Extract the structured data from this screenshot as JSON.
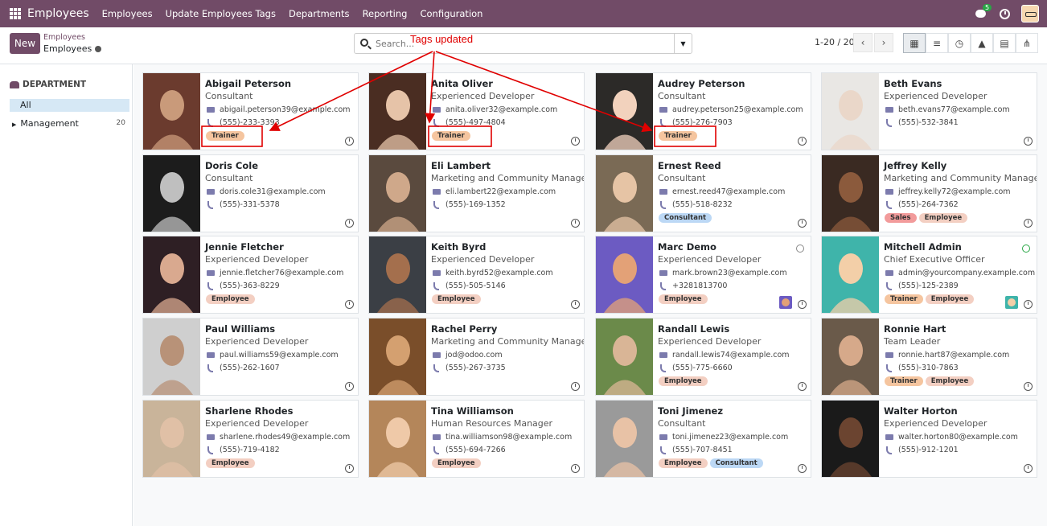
{
  "navbar": {
    "app_name": "Employees",
    "menu": [
      "Employees",
      "Update Employees Tags",
      "Departments",
      "Reporting",
      "Configuration"
    ],
    "chat_badge": "5",
    "accent_color": "#714B67"
  },
  "control_panel": {
    "new_label": "New",
    "breadcrumb_parent": "Employees",
    "breadcrumb_current": "Employees",
    "search_placeholder": "Search...",
    "pager": "1-20 / 20",
    "views": [
      "kanban-icon",
      "list-icon",
      "activity-icon",
      "graph-icon",
      "pivot-icon",
      "hierarchy-icon"
    ],
    "active_view": "kanban"
  },
  "sidebar": {
    "heading": "DEPARTMENT",
    "items": [
      {
        "label": "All",
        "selected": true
      },
      {
        "label": "Management",
        "count": "20"
      }
    ]
  },
  "annotation": {
    "text": "Tags updated",
    "color": "#e00000"
  },
  "employees": [
    {
      "name": "Abigail Peterson",
      "job": "Consultant",
      "email": "abigail.peterson39@example.com",
      "phone": "(555)-233-3393",
      "tags": [
        "Trainer"
      ],
      "status": "",
      "highlight": true
    },
    {
      "name": "Anita Oliver",
      "job": "Experienced Developer",
      "email": "anita.oliver32@example.com",
      "phone": "(555)-497-4804",
      "tags": [
        "Trainer"
      ],
      "status": "",
      "highlight": true
    },
    {
      "name": "Audrey Peterson",
      "job": "Consultant",
      "email": "audrey.peterson25@example.com",
      "phone": "(555)-276-7903",
      "tags": [
        "Trainer"
      ],
      "status": "",
      "highlight": true
    },
    {
      "name": "Beth Evans",
      "job": "Experienced Developer",
      "email": "beth.evans77@example.com",
      "phone": "(555)-532-3841",
      "tags": [],
      "status": ""
    },
    {
      "name": "Doris Cole",
      "job": "Consultant",
      "email": "doris.cole31@example.com",
      "phone": "(555)-331-5378",
      "tags": [],
      "status": ""
    },
    {
      "name": "Eli Lambert",
      "job": "Marketing and Community Manager",
      "email": "eli.lambert22@example.com",
      "phone": "(555)-169-1352",
      "tags": [],
      "status": ""
    },
    {
      "name": "Ernest Reed",
      "job": "Consultant",
      "email": "ernest.reed47@example.com",
      "phone": "(555)-518-8232",
      "tags": [
        "Consultant"
      ],
      "status": ""
    },
    {
      "name": "Jeffrey Kelly",
      "job": "Marketing and Community Manager",
      "email": "jeffrey.kelly72@example.com",
      "phone": "(555)-264-7362",
      "tags": [
        "Sales",
        "Employee"
      ],
      "status": ""
    },
    {
      "name": "Jennie Fletcher",
      "job": "Experienced Developer",
      "email": "jennie.fletcher76@example.com",
      "phone": "(555)-363-8229",
      "tags": [
        "Employee"
      ],
      "status": ""
    },
    {
      "name": "Keith Byrd",
      "job": "Experienced Developer",
      "email": "keith.byrd52@example.com",
      "phone": "(555)-505-5146",
      "tags": [
        "Employee"
      ],
      "status": ""
    },
    {
      "name": "Marc Demo",
      "job": "Experienced Developer",
      "email": "mark.brown23@example.com",
      "phone": "+3281813700",
      "tags": [
        "Employee"
      ],
      "status": "offline",
      "manager_avatar": true
    },
    {
      "name": "Mitchell Admin",
      "job": "Chief Executive Officer",
      "email": "admin@yourcompany.example.com",
      "phone": "(555)-125-2389",
      "tags": [
        "Trainer",
        "Employee"
      ],
      "status": "online",
      "manager_avatar": true
    },
    {
      "name": "Paul Williams",
      "job": "Experienced Developer",
      "email": "paul.williams59@example.com",
      "phone": "(555)-262-1607",
      "tags": [],
      "status": ""
    },
    {
      "name": "Rachel Perry",
      "job": "Marketing and Community Manager",
      "email": "jod@odoo.com",
      "phone": "(555)-267-3735",
      "tags": [],
      "status": ""
    },
    {
      "name": "Randall Lewis",
      "job": "Experienced Developer",
      "email": "randall.lewis74@example.com",
      "phone": "(555)-775-6660",
      "tags": [
        "Employee"
      ],
      "status": ""
    },
    {
      "name": "Ronnie Hart",
      "job": "Team Leader",
      "email": "ronnie.hart87@example.com",
      "phone": "(555)-310-7863",
      "tags": [
        "Trainer",
        "Employee"
      ],
      "status": ""
    },
    {
      "name": "Sharlene Rhodes",
      "job": "Experienced Developer",
      "email": "sharlene.rhodes49@example.com",
      "phone": "(555)-719-4182",
      "tags": [
        "Employee"
      ],
      "status": ""
    },
    {
      "name": "Tina Williamson",
      "job": "Human Resources Manager",
      "email": "tina.williamson98@example.com",
      "phone": "(555)-694-7266",
      "tags": [
        "Employee"
      ],
      "status": ""
    },
    {
      "name": "Toni Jimenez",
      "job": "Consultant",
      "email": "toni.jimenez23@example.com",
      "phone": "(555)-707-8451",
      "tags": [
        "Employee",
        "Consultant"
      ],
      "status": ""
    },
    {
      "name": "Walter Horton",
      "job": "Experienced Developer",
      "email": "walter.horton80@example.com",
      "phone": "(555)-912-1201",
      "tags": [],
      "status": ""
    }
  ]
}
